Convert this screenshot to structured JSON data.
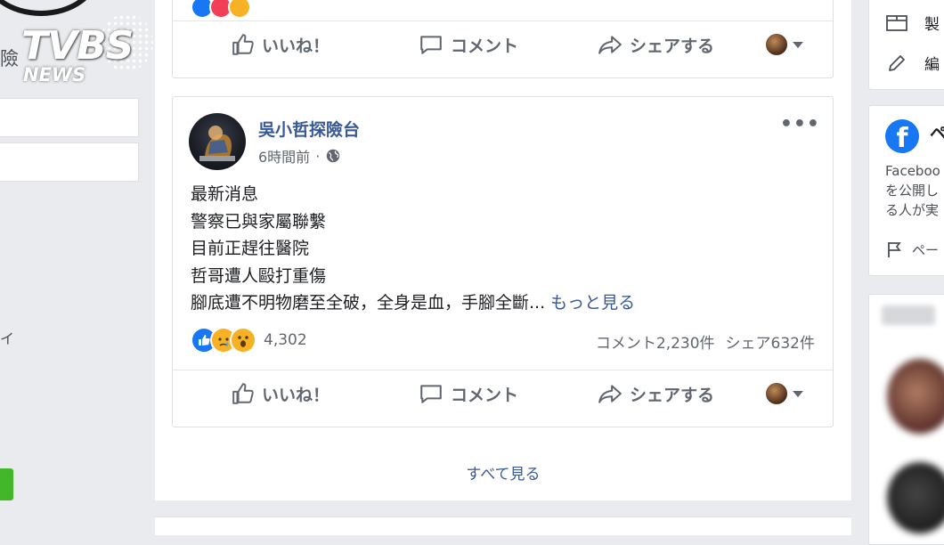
{
  "watermark": {
    "brand": "TVBS",
    "sub": "NEWS"
  },
  "left": {
    "name_fragment": "險",
    "side_char": "イ"
  },
  "top_post": {
    "actions": {
      "like": "いいね！",
      "comment": "コメント",
      "share": "シェアする"
    }
  },
  "post": {
    "page_name": "吳小哲探險台",
    "time": "6時間前",
    "time_separator": "·",
    "more": "•••",
    "lines": [
      "最新消息",
      "警察已與家屬聯繫",
      "目前正趕往醫院",
      "哲哥遭人毆打重傷"
    ],
    "last_line": "腳底遭不明物磨至全破，全身是血，手腳全斷...",
    "see_more": "もっと見る",
    "reaction_count": "4,302",
    "comments": "コメント2,230件",
    "shares": "シェア632件",
    "actions": {
      "like": "いいね！",
      "comment": "コメント",
      "share": "シェアする"
    },
    "reactions": [
      "like-reaction",
      "sad-reaction",
      "wow-reaction"
    ]
  },
  "see_all": "すべて見る",
  "right": {
    "item1": "製",
    "item2": "編",
    "fb_head": "ペ",
    "desc_lines": [
      "Faceboo",
      "を公開し",
      "る人が実"
    ],
    "pe": "ペー"
  },
  "colors": {
    "link": "#385898",
    "brand": "#1877f2",
    "background": "#e9ebee"
  }
}
